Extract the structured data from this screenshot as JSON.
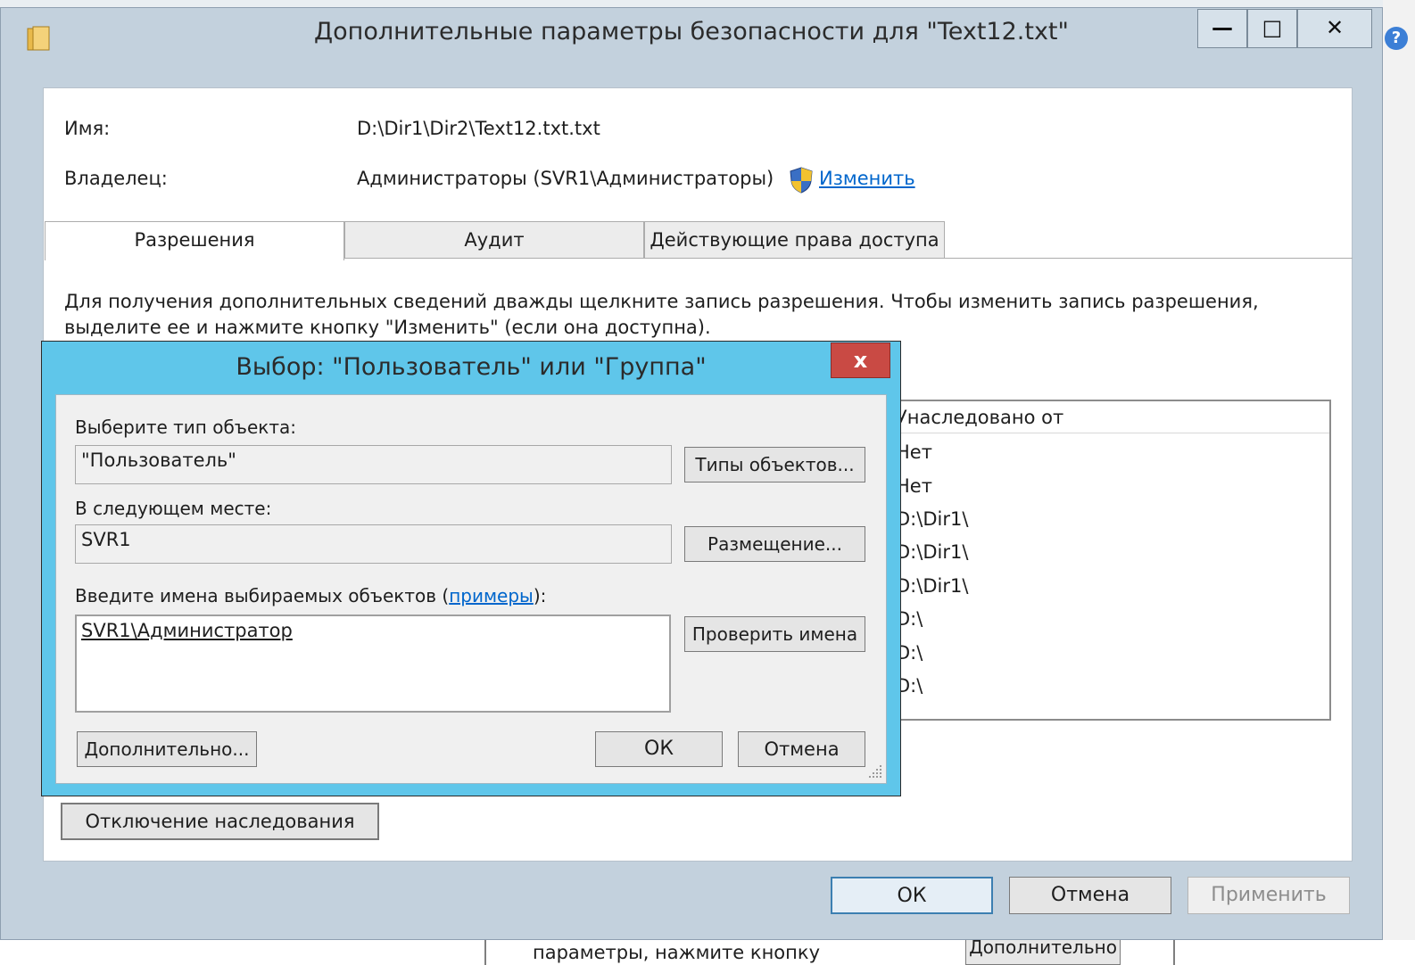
{
  "background": {
    "bottom_text": "параметры, нажмите кнопку",
    "bottom_button": "Дополнительно"
  },
  "main_window": {
    "title": "Дополнительные параметры безопасности  для \"Text12.txt\"",
    "caption_buttons": {
      "minimize": "—",
      "maximize": "□",
      "close": "✕"
    },
    "name_label": "Имя:",
    "name_value": "D:\\Dir1\\Dir2\\Text12.txt.txt",
    "owner_label": "Владелец:",
    "owner_value": "Администраторы (SVR1\\Администраторы)",
    "change_link": "Изменить",
    "tabs": [
      {
        "label": "Разрешения"
      },
      {
        "label": "Аудит"
      },
      {
        "label": "Действующие права доступа"
      }
    ],
    "info_text": "Для получения дополнительных сведений дважды щелкните запись разрешения. Чтобы изменить запись разрешения, выделите ее и нажмите кнопку \"Изменить\" (если она доступна).",
    "permissions_table": {
      "header": "Унаследовано от",
      "rows": [
        "Нет",
        "Нет",
        "D:\\Dir1\\",
        "D:\\Dir1\\",
        "D:\\Dir1\\",
        "D:\\",
        "D:\\",
        "D:\\"
      ]
    },
    "disable_inheritance_button": "Отключение наследования",
    "ok_button": "ОК",
    "cancel_button": "Отмена",
    "apply_button": "Применить"
  },
  "dialog": {
    "title": "Выбор: \"Пользователь\" или \"Группа\"",
    "close": "x",
    "object_type_label": "Выберите тип объекта:",
    "object_type_value": "\"Пользователь\"",
    "object_types_button": "Типы объектов...",
    "location_label": "В следующем месте:",
    "location_value": "SVR1",
    "location_button": "Размещение...",
    "names_label_prefix": "Введите имена выбираемых объектов (",
    "names_examples_link": "примеры",
    "names_label_suffix": "):",
    "names_value": "SVR1\\Администратор",
    "check_names_button": "Проверить имена",
    "advanced_button": "Дополнительно...",
    "ok_button": "ОК",
    "cancel_button": "Отмена"
  }
}
